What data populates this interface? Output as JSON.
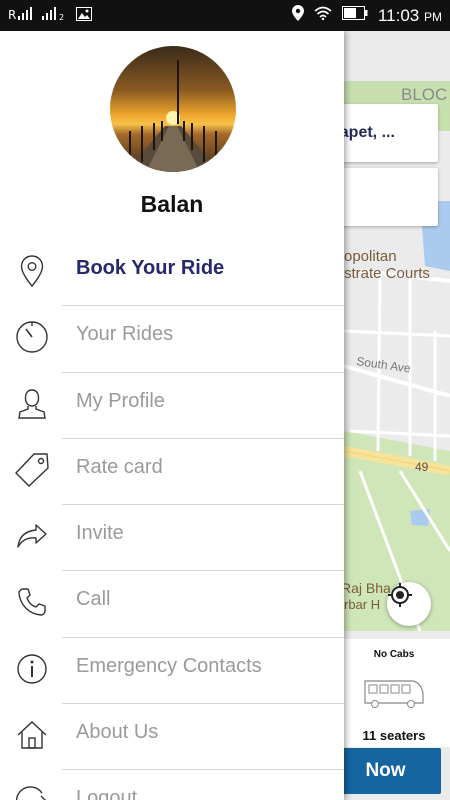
{
  "status_bar": {
    "sim1": "R",
    "sim2": "2",
    "time": "11:03",
    "ampm": "PM"
  },
  "map": {
    "label_top": "BLOC",
    "label_courts_1": "opolitan",
    "label_courts_2": "strate Courts",
    "label_street": "South Ave",
    "label_road_num": "49",
    "label_raj_1": "Raj Bha",
    "label_raj_2": "rbar H"
  },
  "pickup": {
    "text": "dapet, ..."
  },
  "cab_panel": {
    "status": "No Cabs",
    "seats": "11 seaters"
  },
  "book_button": {
    "label": "Now"
  },
  "drawer": {
    "username": "Balan",
    "items": [
      {
        "label": "Book Your Ride",
        "icon": "location-pin-icon",
        "active": true
      },
      {
        "label": "Your Rides",
        "icon": "clock-icon",
        "active": false
      },
      {
        "label": "My Profile",
        "icon": "profile-icon",
        "active": false
      },
      {
        "label": "Rate card",
        "icon": "tag-icon",
        "active": false
      },
      {
        "label": "Invite",
        "icon": "share-arrow-icon",
        "active": false
      },
      {
        "label": "Call",
        "icon": "phone-icon",
        "active": false
      },
      {
        "label": "Emergency Contacts",
        "icon": "info-icon",
        "active": false
      },
      {
        "label": "About Us",
        "icon": "home-icon",
        "active": false
      },
      {
        "label": "Logout",
        "icon": "logout-icon",
        "active": false
      }
    ]
  },
  "colors": {
    "accent": "#26296a",
    "button": "#1565a0",
    "menu_text": "#9a9a9a"
  }
}
